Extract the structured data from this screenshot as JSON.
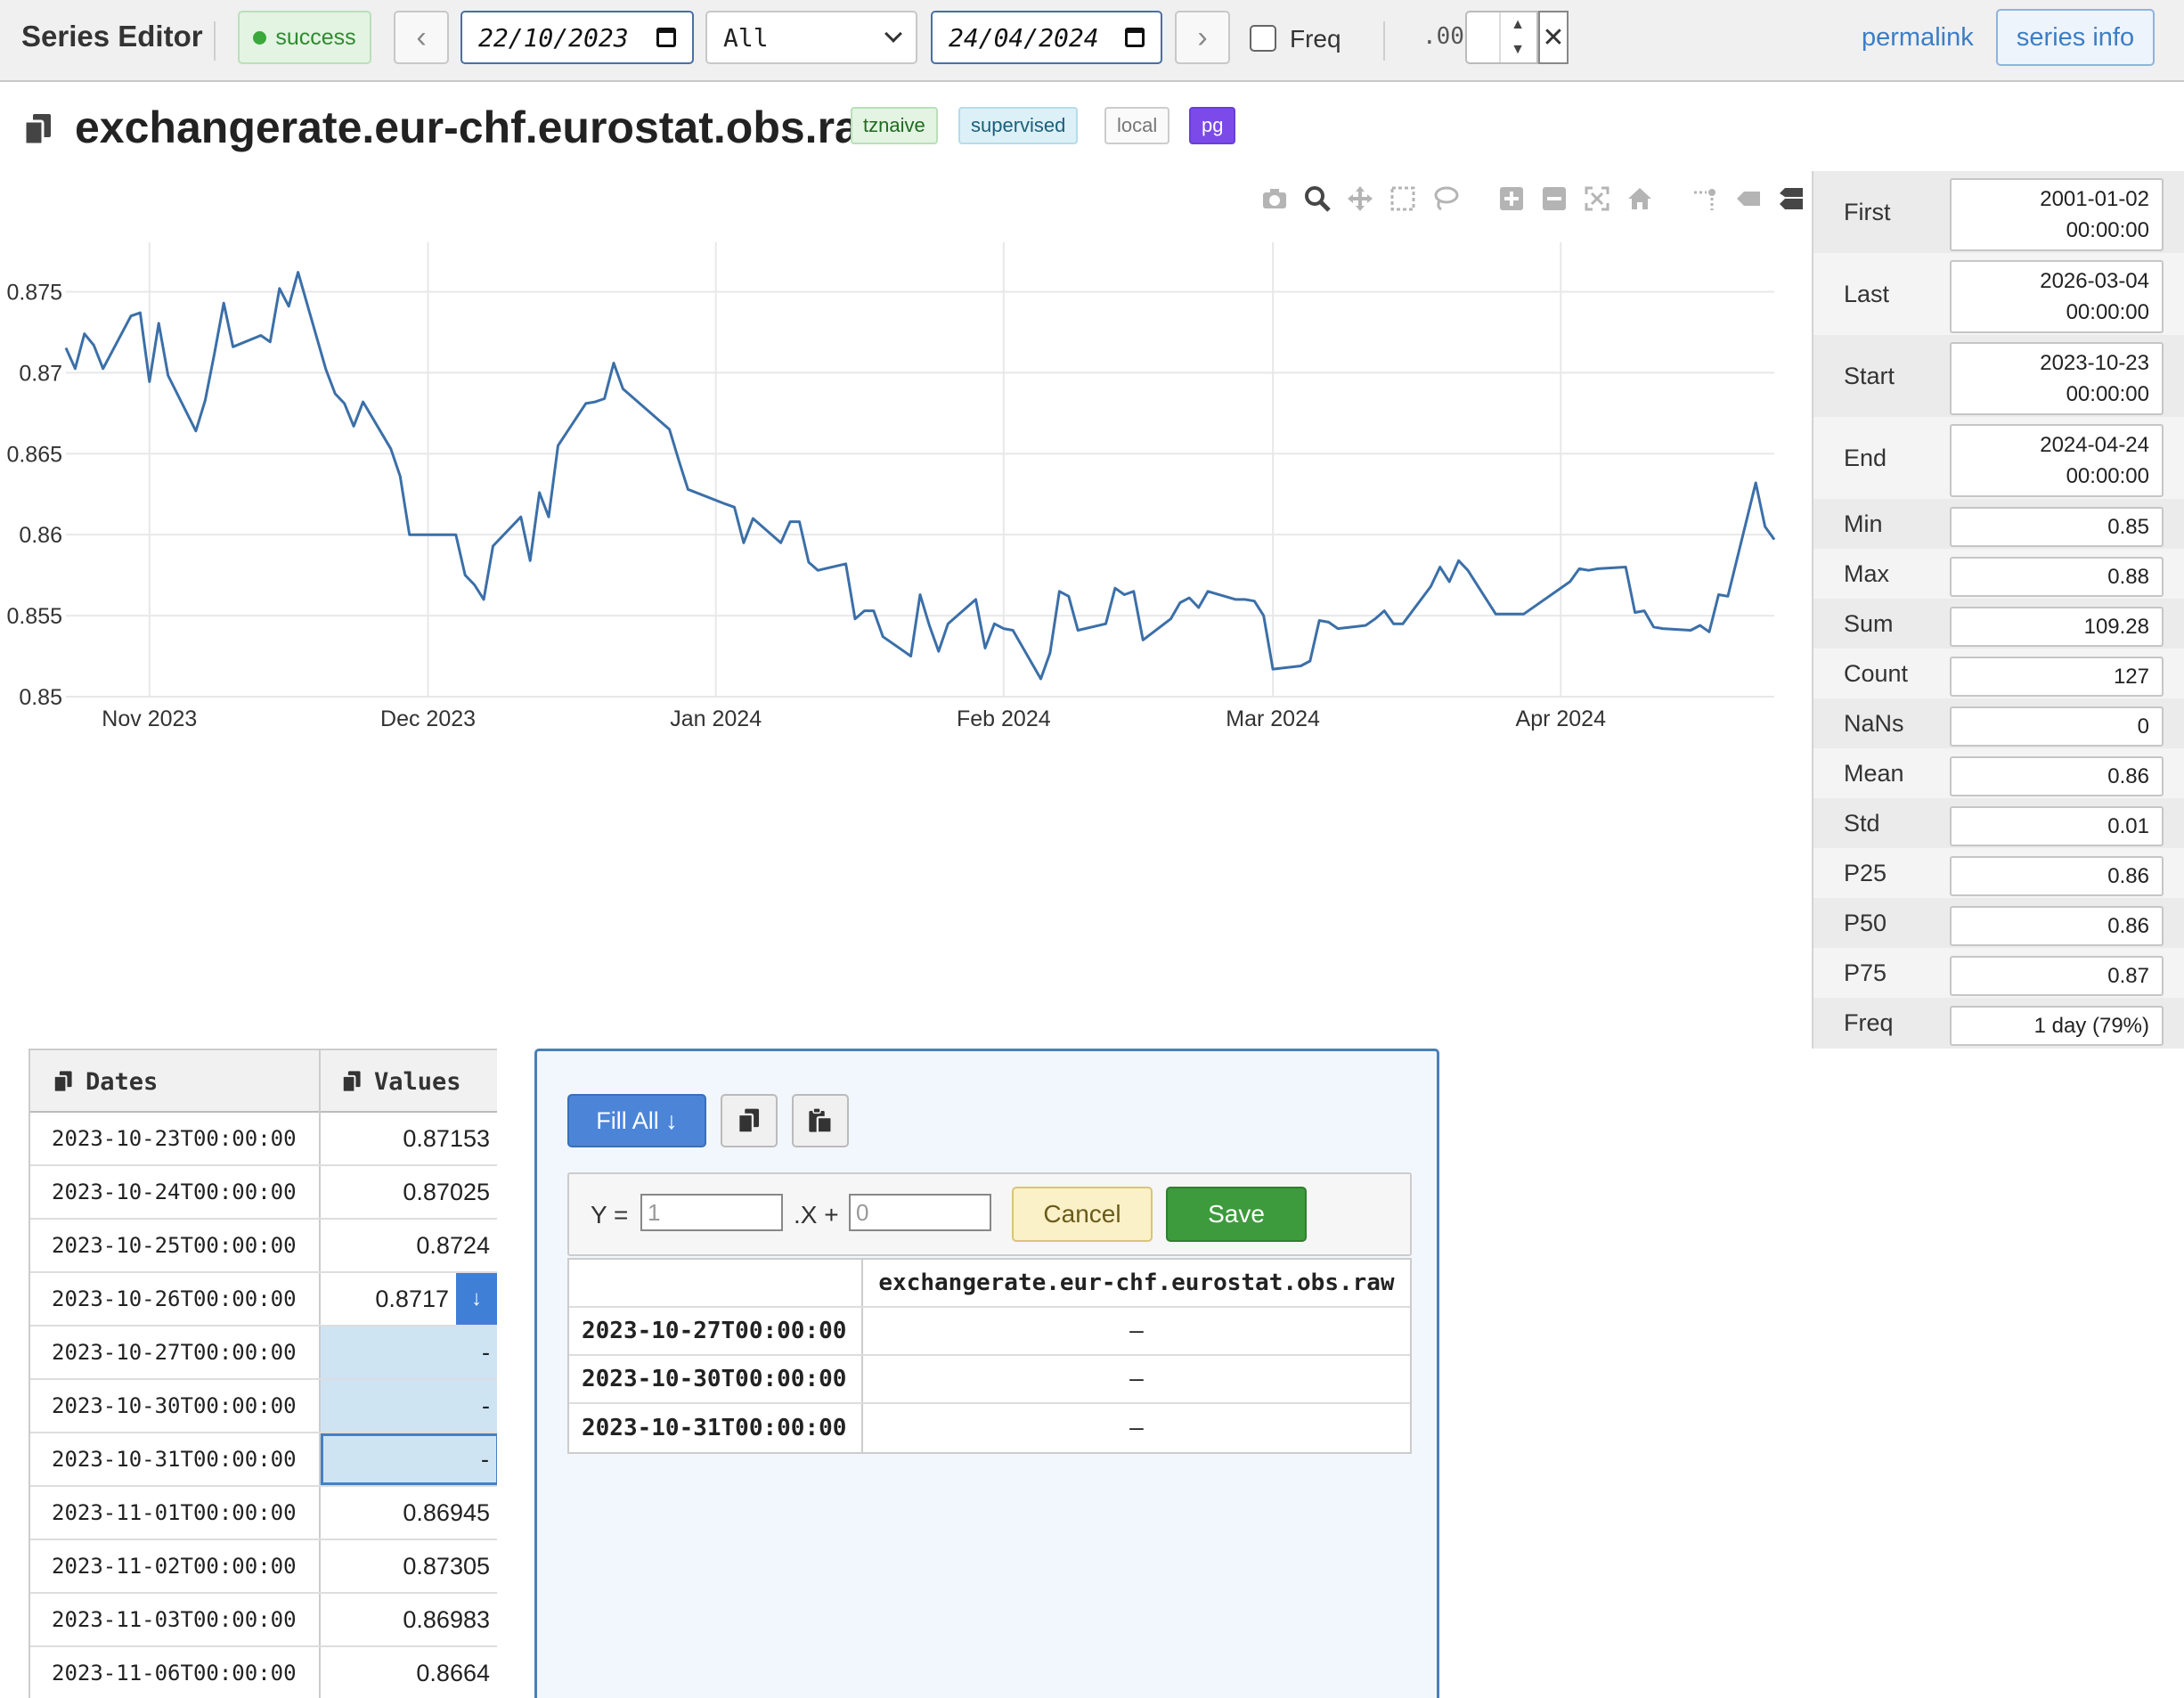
{
  "app": {
    "title": "Series Editor",
    "status": "success"
  },
  "toolbar": {
    "from_date": "22/10/2023",
    "range_select": "All",
    "to_date": "24/04/2024",
    "freq_label": "Freq",
    "decimals_label": ".00",
    "permalink_label": "permalink",
    "series_info_label": "series info"
  },
  "series": {
    "name": "exchangerate.eur-chf.eurostat.obs.raw",
    "tags": [
      "tznaive",
      "supervised",
      "local",
      "pg"
    ]
  },
  "stats": [
    {
      "label": "First",
      "value": "2001-01-02 00:00:00",
      "v1": "2001-01-02",
      "v2": "00:00:00"
    },
    {
      "label": "Last",
      "value": "2026-03-04 00:00:00",
      "v1": "2026-03-04",
      "v2": "00:00:00"
    },
    {
      "label": "Start",
      "value": "2023-10-23 00:00:00",
      "v1": "2023-10-23",
      "v2": "00:00:00"
    },
    {
      "label": "End",
      "value": "2024-04-24 00:00:00",
      "v1": "2024-04-24",
      "v2": "00:00:00"
    },
    {
      "label": "Min",
      "value": "0.85"
    },
    {
      "label": "Max",
      "value": "0.88"
    },
    {
      "label": "Sum",
      "value": "109.28"
    },
    {
      "label": "Count",
      "value": "127"
    },
    {
      "label": "NaNs",
      "value": "0"
    },
    {
      "label": "Mean",
      "value": "0.86"
    },
    {
      "label": "Std",
      "value": "0.01"
    },
    {
      "label": "P25",
      "value": "0.86"
    },
    {
      "label": "P50",
      "value": "0.86"
    },
    {
      "label": "P75",
      "value": "0.87"
    },
    {
      "label": "Freq",
      "value": "1 day (79%)"
    }
  ],
  "grid": {
    "headers": {
      "dates": "Dates",
      "values": "Values"
    },
    "rows": [
      {
        "date": "2023-10-23T00:00:00",
        "value": "0.87153"
      },
      {
        "date": "2023-10-24T00:00:00",
        "value": "0.87025"
      },
      {
        "date": "2023-10-25T00:00:00",
        "value": "0.8724"
      },
      {
        "date": "2023-10-26T00:00:00",
        "value": "0.8717"
      },
      {
        "date": "2023-10-27T00:00:00",
        "value": "-"
      },
      {
        "date": "2023-10-30T00:00:00",
        "value": "-"
      },
      {
        "date": "2023-10-31T00:00:00",
        "value": "-"
      },
      {
        "date": "2023-11-01T00:00:00",
        "value": "0.86945"
      },
      {
        "date": "2023-11-02T00:00:00",
        "value": "0.87305"
      },
      {
        "date": "2023-11-03T00:00:00",
        "value": "0.86983"
      },
      {
        "date": "2023-11-06T00:00:00",
        "value": "0.8664"
      }
    ]
  },
  "fill_panel": {
    "fill_all_label": "Fill All ↓",
    "y_label": "Y =",
    "x_label": ".X +",
    "slope_placeholder": "1",
    "intercept_placeholder": "0",
    "cancel_label": "Cancel",
    "save_label": "Save",
    "preview_header": "exchangerate.eur-chf.eurostat.obs.raw",
    "preview_rows": [
      {
        "date": "2023-10-27T00:00:00",
        "value": "–"
      },
      {
        "date": "2023-10-30T00:00:00",
        "value": "–"
      },
      {
        "date": "2023-10-31T00:00:00",
        "value": "–"
      }
    ]
  },
  "colors": {
    "line": "#3b6fa8",
    "accent": "#3f7fd6",
    "success": "#3aa83a",
    "pg": "#7b4ae8"
  },
  "chart_data": {
    "type": "line",
    "title": "",
    "xlabel": "",
    "ylabel": "",
    "x_ticks": [
      "Nov 2023",
      "Dec 2023",
      "Jan 2024",
      "Feb 2024",
      "Mar 2024",
      "Apr 2024"
    ],
    "x_tick_dates": [
      "2023-11-01",
      "2023-12-01",
      "2024-01-01",
      "2024-02-01",
      "2024-03-01",
      "2024-04-01"
    ],
    "y_ticks": [
      0.85,
      0.855,
      0.86,
      0.865,
      0.87,
      0.875
    ],
    "y_tick_labels": [
      "0.85",
      "0.855",
      "0.86",
      "0.865",
      "0.87",
      "0.875"
    ],
    "xlim": [
      "2023-10-23",
      "2024-04-24"
    ],
    "ylim": [
      0.85,
      0.8775
    ],
    "grid": true,
    "series": [
      {
        "x": [
          "2023-10-23",
          "2023-10-24",
          "2023-10-25",
          "2023-10-26",
          "2023-10-27",
          "2023-10-30",
          "2023-10-31",
          "2023-11-01",
          "2023-11-02",
          "2023-11-03",
          "2023-11-06",
          "2023-11-07",
          "2023-11-08",
          "2023-11-09",
          "2023-11-10",
          "2023-11-13",
          "2023-11-14",
          "2023-11-15",
          "2023-11-16",
          "2023-11-17",
          "2023-11-20",
          "2023-11-21",
          "2023-11-22",
          "2023-11-23",
          "2023-11-24",
          "2023-11-27",
          "2023-11-28",
          "2023-11-29",
          "2023-11-30",
          "2023-12-01",
          "2023-12-04",
          "2023-12-05",
          "2023-12-06",
          "2023-12-07",
          "2023-12-08",
          "2023-12-11",
          "2023-12-12",
          "2023-12-13",
          "2023-12-14",
          "2023-12-15",
          "2023-12-18",
          "2023-12-19",
          "2023-12-20",
          "2023-12-21",
          "2023-12-22",
          "2023-12-27",
          "2023-12-28",
          "2023-12-29",
          "2024-01-02",
          "2024-01-03",
          "2024-01-04",
          "2024-01-05",
          "2024-01-08",
          "2024-01-09",
          "2024-01-10",
          "2024-01-11",
          "2024-01-12",
          "2024-01-15",
          "2024-01-16",
          "2024-01-17",
          "2024-01-18",
          "2024-01-19",
          "2024-01-22",
          "2024-01-23",
          "2024-01-24",
          "2024-01-25",
          "2024-01-26",
          "2024-01-29",
          "2024-01-30",
          "2024-01-31",
          "2024-02-01",
          "2024-02-02",
          "2024-02-05",
          "2024-02-06",
          "2024-02-07",
          "2024-02-08",
          "2024-02-09",
          "2024-02-12",
          "2024-02-13",
          "2024-02-14",
          "2024-02-15",
          "2024-02-16",
          "2024-02-19",
          "2024-02-20",
          "2024-02-21",
          "2024-02-22",
          "2024-02-23",
          "2024-02-26",
          "2024-02-27",
          "2024-02-28",
          "2024-02-29",
          "2024-03-01",
          "2024-03-04",
          "2024-03-05",
          "2024-03-06",
          "2024-03-07",
          "2024-03-08",
          "2024-03-11",
          "2024-03-12",
          "2024-03-13",
          "2024-03-14",
          "2024-03-15",
          "2024-03-18",
          "2024-03-19",
          "2024-03-20",
          "2024-03-21",
          "2024-03-22",
          "2024-03-25",
          "2024-03-26",
          "2024-03-27",
          "2024-03-28",
          "2024-04-02",
          "2024-04-03",
          "2024-04-04",
          "2024-04-05",
          "2024-04-08",
          "2024-04-09",
          "2024-04-10",
          "2024-04-11",
          "2024-04-12",
          "2024-04-15",
          "2024-04-16",
          "2024-04-17",
          "2024-04-18",
          "2024-04-19",
          "2024-04-22",
          "2024-04-23",
          "2024-04-24"
        ],
        "y": [
          0.87153,
          0.87025,
          0.8724,
          0.8717,
          0.87025,
          0.8735,
          0.8737,
          0.86945,
          0.87305,
          0.86983,
          0.8664,
          0.8683,
          0.8712,
          0.8743,
          0.8716,
          0.8723,
          0.8719,
          0.8752,
          0.8741,
          0.8762,
          0.8702,
          0.8687,
          0.8681,
          0.8667,
          0.8682,
          0.8653,
          0.8636,
          0.86,
          0.86,
          0.86,
          0.86,
          0.8575,
          0.8569,
          0.856,
          0.8593,
          0.8611,
          0.8584,
          0.8626,
          0.8611,
          0.8655,
          0.8681,
          0.8682,
          0.8684,
          0.8706,
          0.869,
          0.8665,
          0.8646,
          0.8628,
          0.8619,
          0.8617,
          0.8595,
          0.861,
          0.8595,
          0.8608,
          0.8608,
          0.8583,
          0.8578,
          0.8582,
          0.8548,
          0.8553,
          0.8553,
          0.8537,
          0.8525,
          0.8563,
          0.8544,
          0.8528,
          0.8545,
          0.856,
          0.853,
          0.8545,
          0.8542,
          0.8541,
          0.8511,
          0.8527,
          0.8565,
          0.8562,
          0.8541,
          0.8545,
          0.8567,
          0.8563,
          0.8565,
          0.8535,
          0.8548,
          0.8558,
          0.8561,
          0.8555,
          0.8565,
          0.856,
          0.856,
          0.8559,
          0.855,
          0.8517,
          0.8519,
          0.8522,
          0.8547,
          0.8546,
          0.8542,
          0.8544,
          0.8548,
          0.8553,
          0.8545,
          0.8545,
          0.8568,
          0.858,
          0.8571,
          0.8584,
          0.8578,
          0.8551,
          0.8551,
          0.8551,
          0.8551,
          0.8571,
          0.8579,
          0.8578,
          0.8579,
          0.858,
          0.8552,
          0.8553,
          0.8543,
          0.8542,
          0.8541,
          0.8544,
          0.854,
          0.8563,
          0.8562,
          0.8632,
          0.8605,
          0.8597
        ]
      }
    ]
  }
}
